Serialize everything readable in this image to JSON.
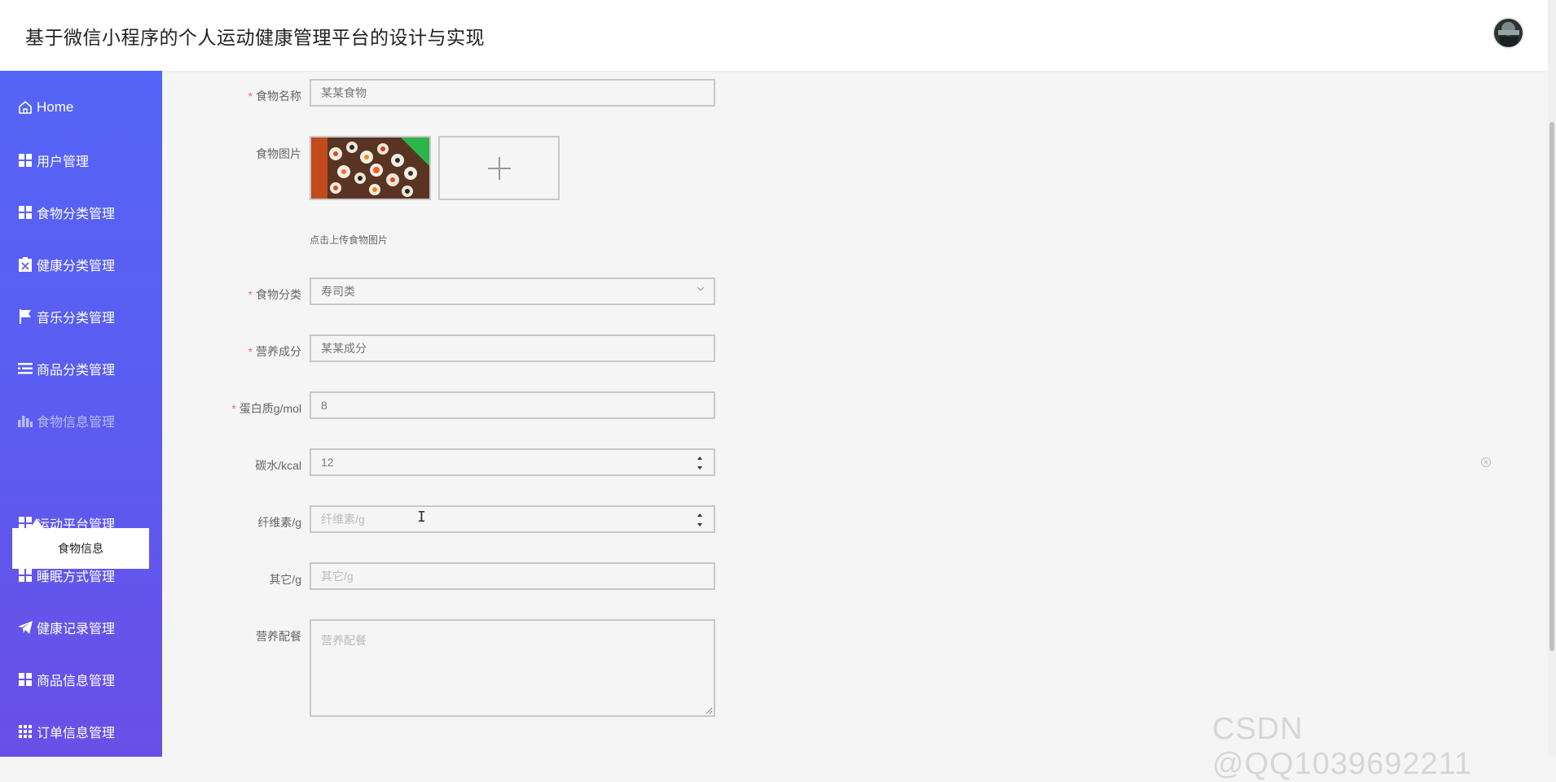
{
  "header": {
    "title": "基于微信小程序的个人运动健康管理平台的设计与实现",
    "avatar_icon": "user-avatar"
  },
  "sidebar": {
    "items": [
      {
        "label": "Home",
        "icon": "home-icon"
      },
      {
        "label": "用户管理",
        "icon": "grid-icon"
      },
      {
        "label": "食物分类管理",
        "icon": "grid-icon"
      },
      {
        "label": "健康分类管理",
        "icon": "clipboard-x-icon"
      },
      {
        "label": "音乐分类管理",
        "icon": "flag-icon"
      },
      {
        "label": "商品分类管理",
        "icon": "list-icon"
      },
      {
        "label": "食物信息管理",
        "icon": "bar-chart-icon"
      },
      {
        "label": "运动平台管理",
        "icon": "grid-icon"
      },
      {
        "label": "睡眠方式管理",
        "icon": "grid-icon"
      },
      {
        "label": "健康记录管理",
        "icon": "send-icon"
      },
      {
        "label": "商品信息管理",
        "icon": "grid-icon"
      },
      {
        "label": "订单信息管理",
        "icon": "grid-9-icon"
      }
    ],
    "submenu": {
      "label": "食物信息"
    }
  },
  "form": {
    "required_mark": "*",
    "food_name": {
      "label": "食物名称",
      "value": "某某食物"
    },
    "food_image": {
      "label": "食物图片",
      "tip": "点击上传食物图片"
    },
    "food_category": {
      "label": "食物分类",
      "value": "寿司类"
    },
    "nutrition": {
      "label": "营养成分",
      "value": "某某成分"
    },
    "protein": {
      "label": "蛋白质g/mol",
      "value": "8"
    },
    "carbs": {
      "label": "碳水/kcal",
      "value": "12"
    },
    "fiber": {
      "label": "纤维素/g",
      "placeholder": "纤维素/g"
    },
    "other": {
      "label": "其它/g",
      "placeholder": "其它/g"
    },
    "meal_plan": {
      "label": "营养配餐",
      "placeholder": "营养配餐"
    }
  },
  "watermark": "CSDN @QQ1039692211",
  "colors": {
    "sidebar_top": "#5565f7",
    "sidebar_bottom": "#6a4fe6",
    "required": "#f56c6c"
  }
}
